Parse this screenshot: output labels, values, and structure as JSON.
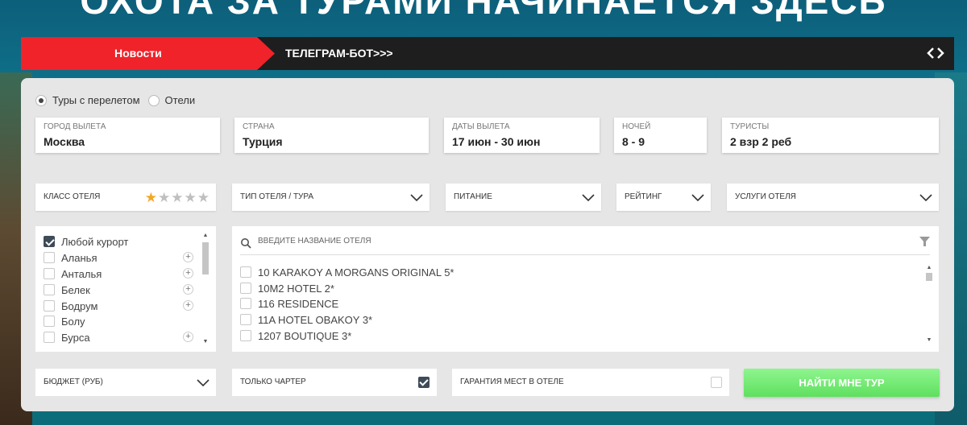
{
  "hero": {
    "title": "ОХОТА ЗА ТУРАМИ НАЧИНАЕТСЯ ЗДЕСЬ"
  },
  "newsbar": {
    "news_label": "Новости",
    "telegram_label": "ТЕЛЕГРАМ-БОТ>>>",
    "code_icon": "code-brackets-icon"
  },
  "search_type": {
    "options": [
      {
        "label": "Туры с перелетом",
        "selected": true
      },
      {
        "label": "Отели",
        "selected": false
      }
    ]
  },
  "fields": {
    "city": {
      "label": "ГОРОД ВЫЛЕТА",
      "value": "Москва"
    },
    "country": {
      "label": "СТРАНА",
      "value": "Турция"
    },
    "dates": {
      "label": "ДАТЫ ВЫЛЕТА",
      "value": "17 июн - 30 июн"
    },
    "nights": {
      "label": "НОЧЕЙ",
      "value": "8 - 9"
    },
    "tourists": {
      "label": "ТУРИСТЫ",
      "value": "2 взр 2 реб"
    }
  },
  "filters": {
    "hotel_class": {
      "label": "КЛАСС ОТЕЛЯ",
      "stars_selected": 1,
      "stars_total": 5
    },
    "hotel_type": {
      "label": "ТИП ОТЕЛЯ / ТУРА"
    },
    "meals": {
      "label": "ПИТАНИЕ"
    },
    "rating": {
      "label": "РЕЙТИНГ"
    },
    "services": {
      "label": "УСЛУГИ ОТЕЛЯ"
    }
  },
  "resorts": {
    "items": [
      {
        "label": "Любой курорт",
        "checked": true,
        "expandable": false
      },
      {
        "label": "Аланья",
        "checked": false,
        "expandable": true
      },
      {
        "label": "Анталья",
        "checked": false,
        "expandable": true
      },
      {
        "label": "Белек",
        "checked": false,
        "expandable": true
      },
      {
        "label": "Бодрум",
        "checked": false,
        "expandable": true
      },
      {
        "label": "Болу",
        "checked": false,
        "expandable": false
      },
      {
        "label": "Бурса",
        "checked": false,
        "expandable": true
      }
    ]
  },
  "hotels": {
    "search_placeholder": "ВВЕДИТЕ НАЗВАНИЕ ОТЕЛЯ",
    "items": [
      "10 KARAKOY A MORGANS ORIGINAL 5*",
      "10M2 HOTEL 2*",
      "116 RESIDENCE",
      "11A HOTEL OBAKOY 3*",
      "1207 BOUTIQUE 3*"
    ]
  },
  "bottom": {
    "budget": {
      "label": "БЮДЖЕТ (РУБ)"
    },
    "charter": {
      "label": "ТОЛЬКО ЧАРТЕР",
      "checked": true
    },
    "guarantee": {
      "label": "ГАРАНТИЯ МЕСТ В ОТЕЛЕ",
      "checked": false
    },
    "find_button": "НАЙТИ МНЕ ТУР"
  },
  "colors": {
    "accent_red": "#f0232a",
    "button_green": "#5fe05f",
    "star_active": "#f5a623"
  }
}
